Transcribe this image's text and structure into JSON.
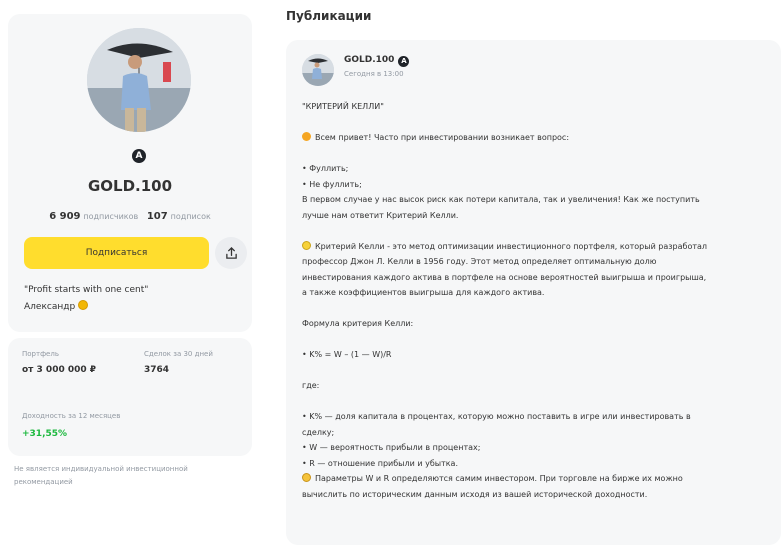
{
  "profile": {
    "badge": "A",
    "name": "GOLD.100",
    "subscribers_count": "6 909",
    "subscribers_label": "подписчиков",
    "subscriptions_count": "107",
    "subscriptions_label": "подписок",
    "subscribe_label": "Подписаться",
    "bio_line1": "\"Profit starts with one cent\"",
    "bio_line2": "Александр"
  },
  "stats": {
    "portfolio_label": "Портфель",
    "portfolio_value": "от 3 000 000 ₽",
    "deals_label": "Сделок за 30 дней",
    "deals_value": "3764",
    "yield_label": "Доходность за 12 месяцев",
    "yield_value": "+31,55%"
  },
  "disclaimer": "Не является индивидуальной инвестиционной рекомендацией",
  "publications": {
    "title": "Публикации",
    "post": {
      "author": "GOLD.100",
      "badge": "A",
      "time": "Сегодня в 13:00",
      "lines": [
        "\"КРИТЕРИЙ КЕЛЛИ\"",
        "",
        "Всем привет! Часто при инвестировании возникает вопрос:",
        "",
        "• Фуллить;",
        "• Не фуллить;",
        "В первом случае у нас высок риск как потери капитала, так и увеличения! Как же поступить",
        "лучше нам ответит Критерий Келли.",
        "",
        "Критерий Келли - это метод оптимизации инвестиционного портфеля, который разработал",
        "профессор Джон Л. Келли в 1956 году. Этот метод определяет оптимальную долю",
        "инвестирования каждого актива в портфеле на основе вероятностей выигрыша и проигрыша,",
        "а также коэффициентов выигрыша для каждого актива.",
        "",
        "Формула критерия Келли:",
        "",
        "• K% = W – (1 — W)/R",
        "",
        "где:",
        "",
        "• K% — доля капитала в процентах, которую можно поставить в игре или инвестировать в",
        "сделку;",
        "• W — вероятность прибыли в процентах;",
        "• R — отношение прибыли и убытка.",
        "Параметры W и R определяются самим инвестором. При торговле на бирже их можно",
        "вычислить по историческим данным исходя из вашей исторической доходности."
      ]
    }
  },
  "icons": {
    "share": "share-icon",
    "verified": "verified-badge-icon",
    "hand": "waving-hand-emoji-icon",
    "bulb": "light-bulb-emoji-icon",
    "smile": "smiling-emoji-icon",
    "coin": "coin-emoji-icon"
  },
  "colors": {
    "accent": "#ffdd2d",
    "positive": "#1db93f",
    "card_bg": "#f6f7f8",
    "muted_text": "#9299a2"
  }
}
